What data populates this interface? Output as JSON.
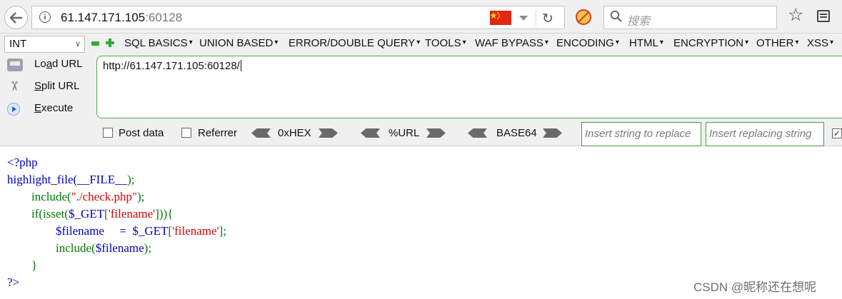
{
  "browser": {
    "url_host": "61.147.171.105",
    "url_port": ":60128",
    "search_placeholder": "搜索",
    "icons": [
      "back-arrow-icon",
      "info-icon",
      "china-flag-icon",
      "dropdown-arrow-icon",
      "reload-icon",
      "block-icon",
      "search-icon",
      "bookmark-star-icon",
      "reader-list-icon"
    ]
  },
  "hackbar": {
    "int_select": "INT",
    "menus": [
      "SQL BASICS",
      "UNION BASED",
      "ERROR/DOUBLE QUERY",
      "TOOLS",
      "WAF BYPASS",
      "ENCODING",
      "HTML",
      "ENCRYPTION",
      "OTHER",
      "XSS"
    ],
    "side_buttons": [
      {
        "prefix": "Lo",
        "underline": "a",
        "rest": "d URL"
      },
      {
        "prefix": "",
        "underline": "S",
        "rest": "plit URL"
      },
      {
        "prefix": "",
        "underline": "E",
        "rest": "xecute"
      }
    ],
    "url_value": "http://61.147.171.105:60128/",
    "options": {
      "post_data": "Post data",
      "referrer": "Referrer"
    },
    "encoders": [
      "0xHEX",
      "%URL",
      "BASE64"
    ],
    "replace_placeholder": "Insert string to replace",
    "replacing_placeholder": "Insert replacing string",
    "colors": {
      "accent_green": "#2faa2f",
      "input_border": "#4a9a4a"
    }
  },
  "source": {
    "line1": "<?php",
    "line2_a": "highlight_file(",
    "line2_b": "__FILE__",
    "line2_c": ");",
    "line3_a": "        include(",
    "line3_b": "\"./check.php\"",
    "line3_c": ");",
    "line4_a": "        if(isset(",
    "line4_b": "$_GET",
    "line4_c": "[",
    "line4_d": "'filename'",
    "line4_e": "])){",
    "line5_a": "                $filename     =  ",
    "line5_b": "$_GET",
    "line5_c": "[",
    "line5_d": "'filename'",
    "line5_e": "];",
    "line6_a": "                include(",
    "line6_b": "$filename",
    "line6_c": ");",
    "line7": "        }",
    "line8": "?>",
    "colors": {
      "keyword": "#0000bb",
      "string": "#dd0000",
      "operator": "#007700"
    }
  },
  "watermark": "CSDN @昵称还在想呢"
}
